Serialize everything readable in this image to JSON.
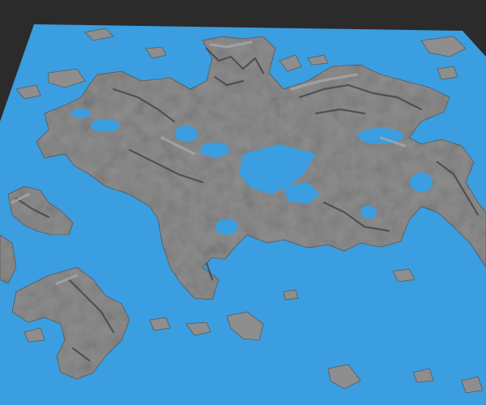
{
  "scene": {
    "name": "terrain-heightmap-render",
    "colors": {
      "background": "#2b2b2b",
      "water": "#3a9ee0",
      "land": "#8e8e8e",
      "land_light": "#a7a7a7",
      "land_dark": "#5a5a5a",
      "ridge": "#3f3f3f"
    }
  }
}
